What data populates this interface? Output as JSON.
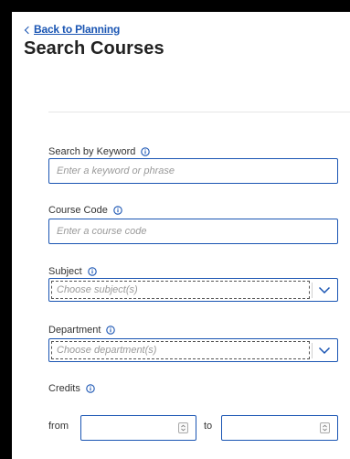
{
  "header": {
    "back_link": "Back to Planning",
    "title": "Search Courses"
  },
  "keyword": {
    "label": "Search by Keyword",
    "placeholder": "Enter a keyword or phrase",
    "value": ""
  },
  "course_code": {
    "label": "Course Code",
    "placeholder": "Enter a course code",
    "value": ""
  },
  "subject": {
    "label": "Subject",
    "placeholder": "Choose subject(s)"
  },
  "department": {
    "label": "Department",
    "placeholder": "Choose department(s)"
  },
  "credits": {
    "label": "Credits",
    "from_label": "from",
    "to_label": "to",
    "from_value": "",
    "to_value": ""
  },
  "icons": {
    "info": "info-icon",
    "back": "chevron-left-icon",
    "dropdown": "chevron-down-icon",
    "spinner": "spinner-arrows-icon"
  },
  "colors": {
    "accent": "#1a55b3",
    "frame": "#000000",
    "placeholder": "#9a9a9a"
  }
}
